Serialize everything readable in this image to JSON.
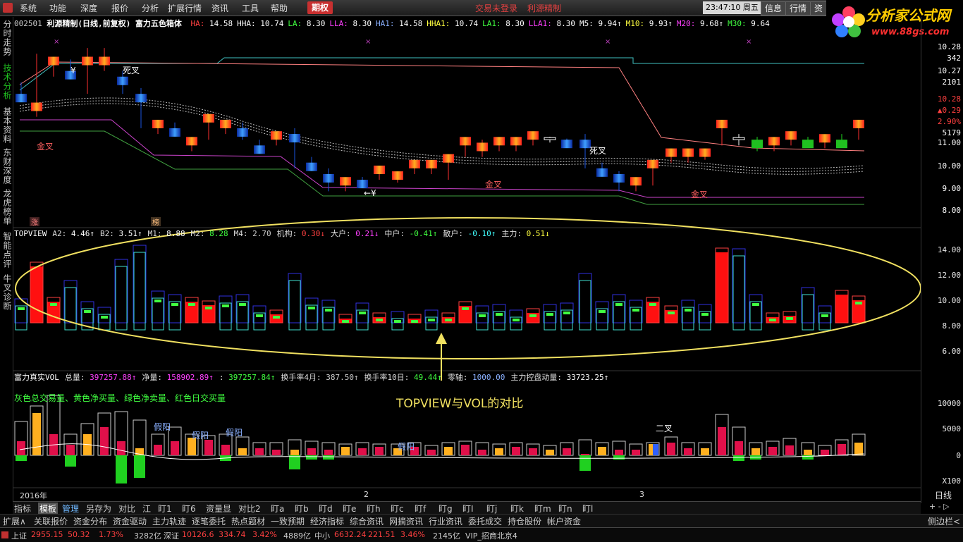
{
  "menu": {
    "items": [
      "系统",
      "功能",
      "深度",
      "报价",
      "分析",
      "扩展行情",
      "资讯",
      "工具",
      "帮助"
    ],
    "active_tab": "期权",
    "trade_login": "交易未登录",
    "stock_short": "利源精制",
    "clock": "23:47:10 周五",
    "right_buttons": [
      "信息",
      "行情",
      "资"
    ]
  },
  "logo": {
    "title": "分析家公式网",
    "url": "www.88gs.com"
  },
  "sidebar": [
    "分时走势",
    "技术分析",
    "基本资料",
    "东财深度",
    "龙虎榜单",
    "智能点评",
    "牛叉诊断"
  ],
  "price_panel": {
    "header_code": "002501",
    "header_title": "利源精制(日线,前复权)",
    "header_indicator": "富力五色箱体",
    "params": [
      {
        "k": "HA:",
        "v": "14.58",
        "c": "#ff4040"
      },
      {
        "k": "HHA:",
        "v": "10.74",
        "c": "#ffffff"
      },
      {
        "k": "LA:",
        "v": "8.30",
        "c": "#40ff40"
      },
      {
        "k": "LLA:",
        "v": "8.30",
        "c": "#ff40ff"
      },
      {
        "k": "HA1:",
        "v": "14.58",
        "c": "#8ab0ff"
      },
      {
        "k": "HHA1:",
        "v": "10.74",
        "c": "#ffff40"
      },
      {
        "k": "LA1:",
        "v": "8.30",
        "c": "#40ff40"
      },
      {
        "k": "LLA1:",
        "v": "8.30",
        "c": "#ff40ff"
      },
      {
        "k": "M5:",
        "v": "9.94↑",
        "c": "#ffffff"
      },
      {
        "k": "M10:",
        "v": "9.93↑",
        "c": "#ffff40"
      },
      {
        "k": "M20:",
        "v": "9.68↑",
        "c": "#ff40ff"
      },
      {
        "k": "M30:",
        "v": "9.64",
        "c": "#40ff40"
      }
    ],
    "axis": [
      "10.28",
      "342",
      "10.27",
      "2101",
      "10.28",
      "▲0.29",
      "2.90%",
      "5179",
      "11.00",
      "10.00",
      "9.00",
      "8.00"
    ],
    "labels": {
      "jincha": "金叉",
      "sicha": "死叉",
      "yen": "¥",
      "arrow_yen": "←¥",
      "zhang": "涨",
      "bang": "榜"
    }
  },
  "topview_panel": {
    "header": [
      {
        "k": "TOPVIEW",
        "v": "",
        "c": "#cccccc"
      },
      {
        "k": "A2:",
        "v": "4.46↑",
        "c": "#ffffff"
      },
      {
        "k": "B2:",
        "v": "3.51↑",
        "c": "#ffffff"
      },
      {
        "k": "M1:",
        "v": "8.88",
        "c": "#ffffff"
      },
      {
        "k": "M2:",
        "v": "8.28",
        "c": "#40ff40"
      },
      {
        "k": "M4:",
        "v": "2.70",
        "c": "#cccccc"
      },
      {
        "k": "机构:",
        "v": "0.30↓",
        "c": "#ff4040"
      },
      {
        "k": "大户:",
        "v": "0.21↓",
        "c": "#ff40ff"
      },
      {
        "k": "中户:",
        "v": "-0.41↑",
        "c": "#40ff40"
      },
      {
        "k": "散户:",
        "v": "-0.10↑",
        "c": "#40ffff"
      },
      {
        "k": "主力:",
        "v": "0.51↓",
        "c": "#ffff40"
      }
    ],
    "axis": [
      "14.00",
      "12.00",
      "10.00",
      "8.00",
      "6.00"
    ],
    "annotation": "TOPVIEW与VOL的对比"
  },
  "vol_panel": {
    "header": [
      {
        "k": "富力真实VOL",
        "v": "",
        "c": "#cccccc"
      },
      {
        "k": "总量:",
        "v": "397257.88↑",
        "c": "#ff40ff"
      },
      {
        "k": "净量:",
        "v": "158902.89↑",
        "c": "#ff40ff"
      },
      {
        "k": ":",
        "v": "397257.84↑",
        "c": "#40ff40"
      },
      {
        "k": "换手率4月:",
        "v": "387.50↑",
        "c": "#cccccc"
      },
      {
        "k": "换手率10日:",
        "v": "49.44↑",
        "c": "#40ff40"
      },
      {
        "k": "零轴:",
        "v": "1000.00",
        "c": "#8ab0ff"
      },
      {
        "k": "主力控盘动量:",
        "v": "33723.25↑",
        "c": "#ffffff"
      }
    ],
    "legend": "灰色总交易量、黄色净买量、绿色净卖量、红色日交买量",
    "axis": [
      "10000",
      "5000",
      "0",
      "X100"
    ],
    "labels": {
      "jiayang": "假阳",
      "erjiao": "二叉"
    }
  },
  "xaxis": {
    "year": "2016年",
    "m2": "2",
    "m3": "3",
    "period": "日线"
  },
  "toolbar": [
    "指标",
    "模板",
    "管理",
    "另存为",
    "对比",
    "江",
    "盯1",
    "盯6",
    "资量显",
    "对比2",
    "盯a",
    "盯b",
    "盯d",
    "盯e",
    "盯h",
    "盯c",
    "盯f",
    "盯g",
    "盯I",
    "盯j",
    "盯k",
    "盯m",
    "盯n",
    "盯l"
  ],
  "toolbar_right": "+ - ▷",
  "bottom_tabs": [
    "扩展∧",
    "关联报价",
    "资金分布",
    "资金驱动",
    "主力轨迹",
    "逐笔委托",
    "热点题材",
    "一致预期",
    "经济指标",
    "综合资讯",
    "网摘资讯",
    "行业资讯",
    "委托成交",
    "持仓股份",
    "帐户资金"
  ],
  "bottom_right": "侧边栏<",
  "status": [
    {
      "t": "上证",
      "c": "#cccccc"
    },
    {
      "t": "2955.15",
      "c": "#ff4040"
    },
    {
      "t": "50.32",
      "c": "#ff4040"
    },
    {
      "t": "1.73%",
      "c": "#ff4040"
    },
    {
      "t": "3282亿",
      "c": "#cccccc"
    },
    {
      "t": "深证",
      "c": "#cccccc"
    },
    {
      "t": "10126.6",
      "c": "#ff4040"
    },
    {
      "t": "334.74",
      "c": "#ff4040"
    },
    {
      "t": "3.42%",
      "c": "#ff4040"
    },
    {
      "t": "4889亿",
      "c": "#cccccc"
    },
    {
      "t": "中小",
      "c": "#cccccc"
    },
    {
      "t": "6632.24",
      "c": "#ff4040"
    },
    {
      "t": "221.51",
      "c": "#ff4040"
    },
    {
      "t": "3.46%",
      "c": "#ff4040"
    },
    {
      "t": "2145亿",
      "c": "#cccccc"
    },
    {
      "t": "VIP_招商北京4",
      "c": "#cccccc"
    }
  ],
  "colors": {
    "up": "#ff2020",
    "down": "#1a4fd8",
    "box_high": "#ff8080",
    "box_low": "#cc44cc",
    "ellipse": "#f0e060",
    "annotation": "#f0e060"
  }
}
